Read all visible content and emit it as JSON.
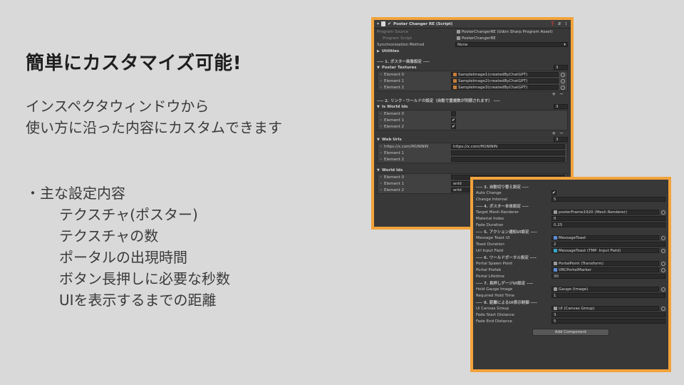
{
  "slide": {
    "title": "簡単にカスタマイズ可能!",
    "desc": [
      "インスペクタウィンドウから",
      "使い方に沿った内容にカスタムできます"
    ],
    "bullet_head": "・主な設定内容",
    "bullets": [
      "テクスチャ(ポスター)",
      "テクスチャの数",
      "ポータルの出現時間",
      "ボタン長押しに必要な秒数",
      "UIを表示するまでの距離"
    ]
  },
  "colors": {
    "highlight": "#f2a33c",
    "panel_bg": "#383838",
    "slide_bg": "#d9d9d9"
  },
  "inspector1": {
    "component_title": "Poster Changer RE (Script)",
    "program_source_label": "Program Source",
    "program_source_value": "PosterChangerRE (Udon Sharp Program Asset)",
    "program_script_label": "Program Script",
    "program_script_value": "PosterChangerRE",
    "sync_label": "Synchronization Method",
    "sync_value": "None",
    "utilities_label": "Utilities",
    "section1": "---- 1. ポスター画像設定 ----",
    "poster_textures_label": "Poster Textures",
    "poster_textures_count": "3",
    "poster_elements": [
      {
        "label": "Element 0",
        "value": "SampleImage1(createdByChatGPT)"
      },
      {
        "label": "Element 1",
        "value": "SampleImage2(createdByChatGPT)"
      },
      {
        "label": "Element 2",
        "value": "SampleImage3(createdByChatGPT)"
      }
    ],
    "section2": "---- 2. リンク・ワールドの設定（自動で重複数が同期されます） ----",
    "is_world_label": "Is World Ids",
    "is_world_count": "3",
    "is_world_elements": [
      {
        "label": "Element 0",
        "checked": ""
      },
      {
        "label": "Element 1",
        "checked": "✔"
      },
      {
        "label": "Element 2",
        "checked": "✔"
      }
    ],
    "web_urls_label": "Web Urls",
    "web_urls_count": "3",
    "web_urls_elements": [
      {
        "label": "https://x.com/M1NININ",
        "value": "https://x.com/M1NININ"
      },
      {
        "label": "Element 1",
        "value": ""
      },
      {
        "label": "Element 2",
        "value": ""
      }
    ],
    "world_ids_label": "World Ids",
    "world_ids_elements": [
      {
        "label": "Element 0",
        "value": ""
      },
      {
        "label": "Element 1",
        "value": "wrld_"
      },
      {
        "label": "Element 2",
        "value": "wrld_"
      }
    ],
    "plus": "+",
    "minus": "−"
  },
  "inspector2": {
    "section3": "---- 3. 自動切り替え設定 ----",
    "auto_change_label": "Auto Change",
    "auto_change_value": "✔",
    "change_interval_label": "Change Interval",
    "change_interval_value": "5",
    "section4": "---- 4. ポスター本体設定 ----",
    "target_mesh_label": "Target Mesh Renderer",
    "target_mesh_value": "posterFrame1920 (Mesh Renderer)",
    "material_index_label": "Material Index",
    "material_index_value": "0",
    "fade_duration_label": "Fade Duration",
    "fade_duration_value": "0.25",
    "section5": "---- 5. アクション通知UI設定 ----",
    "message_toast_label": "Message Toast UI",
    "message_toast_value": "MessageToast",
    "toast_duration_label": "Toast Duration",
    "toast_duration_value": "2",
    "url_input_label": "Url Input Field",
    "url_input_value": "MessageToast (TMP_Input Field)",
    "section6": "---- 6. ワールドポータル設定 ----",
    "portal_spawn_label": "Portal Spawn Point",
    "portal_spawn_value": "PortalPoint (Transform)",
    "portal_prefab_label": "Portal Prefab",
    "portal_prefab_value": "VRCPortalMarker",
    "portal_lifetime_label": "Portal Lifetime",
    "portal_lifetime_value": "30",
    "section7": "---- 7. 長押しゲージUI設定 ----",
    "hold_gauge_label": "Hold Gauge Image",
    "hold_gauge_value": "Gauge (Image)",
    "required_hold_label": "Required Hold Time",
    "required_hold_value": "1",
    "section8": "---- 8. 距離によるUI表示制御 ----",
    "ui_canvas_label": "Ui Canvas Group",
    "ui_canvas_value": "UI (Canvas Group)",
    "fade_start_label": "Fade Start Distance",
    "fade_start_value": "3",
    "fade_end_label": "Fade End Distance",
    "fade_end_value": "5",
    "add_component": "Add Component"
  }
}
